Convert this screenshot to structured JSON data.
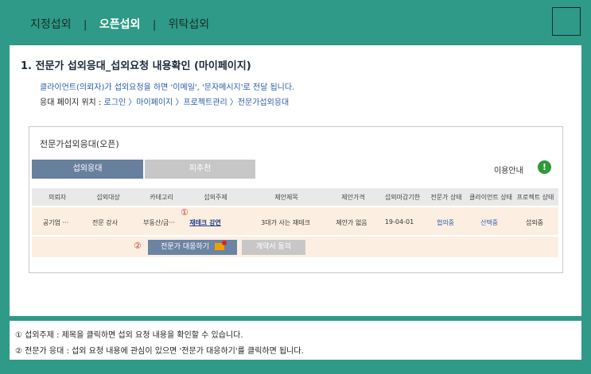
{
  "top_nav": {
    "tabs": [
      {
        "label": "지정섭외",
        "active": false
      },
      {
        "label": "오픈섭외",
        "active": true
      },
      {
        "label": "위탁섭외",
        "active": false
      }
    ],
    "separator": "|"
  },
  "section": {
    "heading": "1. 전문가 섭외응대_섭외요청 내용확인 (마이페이지)",
    "description": "클라이언트(의뢰자)가 섭외요청을 하면 '이메일', '문자메시지'로 전달 됩니다.",
    "path_label": "응대 페이지 위치 :",
    "path": "로그인 〉마이페이지 〉프로젝트관리 〉전문가섭외응대"
  },
  "card": {
    "title": "전문가섭외응대(오픈)",
    "tab_accept": "섭외응대",
    "tab_decline": "피추천",
    "guide_label": "이용안내",
    "guide_icon": "!",
    "columns": [
      "의뢰자",
      "섭외대상",
      "카테고리",
      "섭외주제",
      "제안제목",
      "제안가격",
      "섭외마감기한",
      "전문가 상태",
      "클라이언트 상태",
      "프로젝트 상태"
    ],
    "row": {
      "client": "공기업 ···",
      "target": "전문 강사",
      "category": "부동산/금···",
      "topic": "재테크 강연",
      "proposal_title": "3대가 사는 재테크",
      "price": "제안가 없음",
      "deadline": "19-04-01",
      "expert_status": "협의중",
      "client_status": "선택중",
      "project_status": "섭외중"
    },
    "marker_1": "①",
    "marker_2": "②",
    "respond_button": "전문가 대응하기",
    "contract_button": "계약서 동의"
  },
  "notes": {
    "note_1": "① 섭외주제 : 제목을 클릭하면 섭외 요청 내용을 확인할 수 있습니다.",
    "note_2": "② 전문가 응대 : 섭외 요청 내용에 관심이 있으면 '전문가 대응하기'를 클릭하면 됩니다."
  }
}
